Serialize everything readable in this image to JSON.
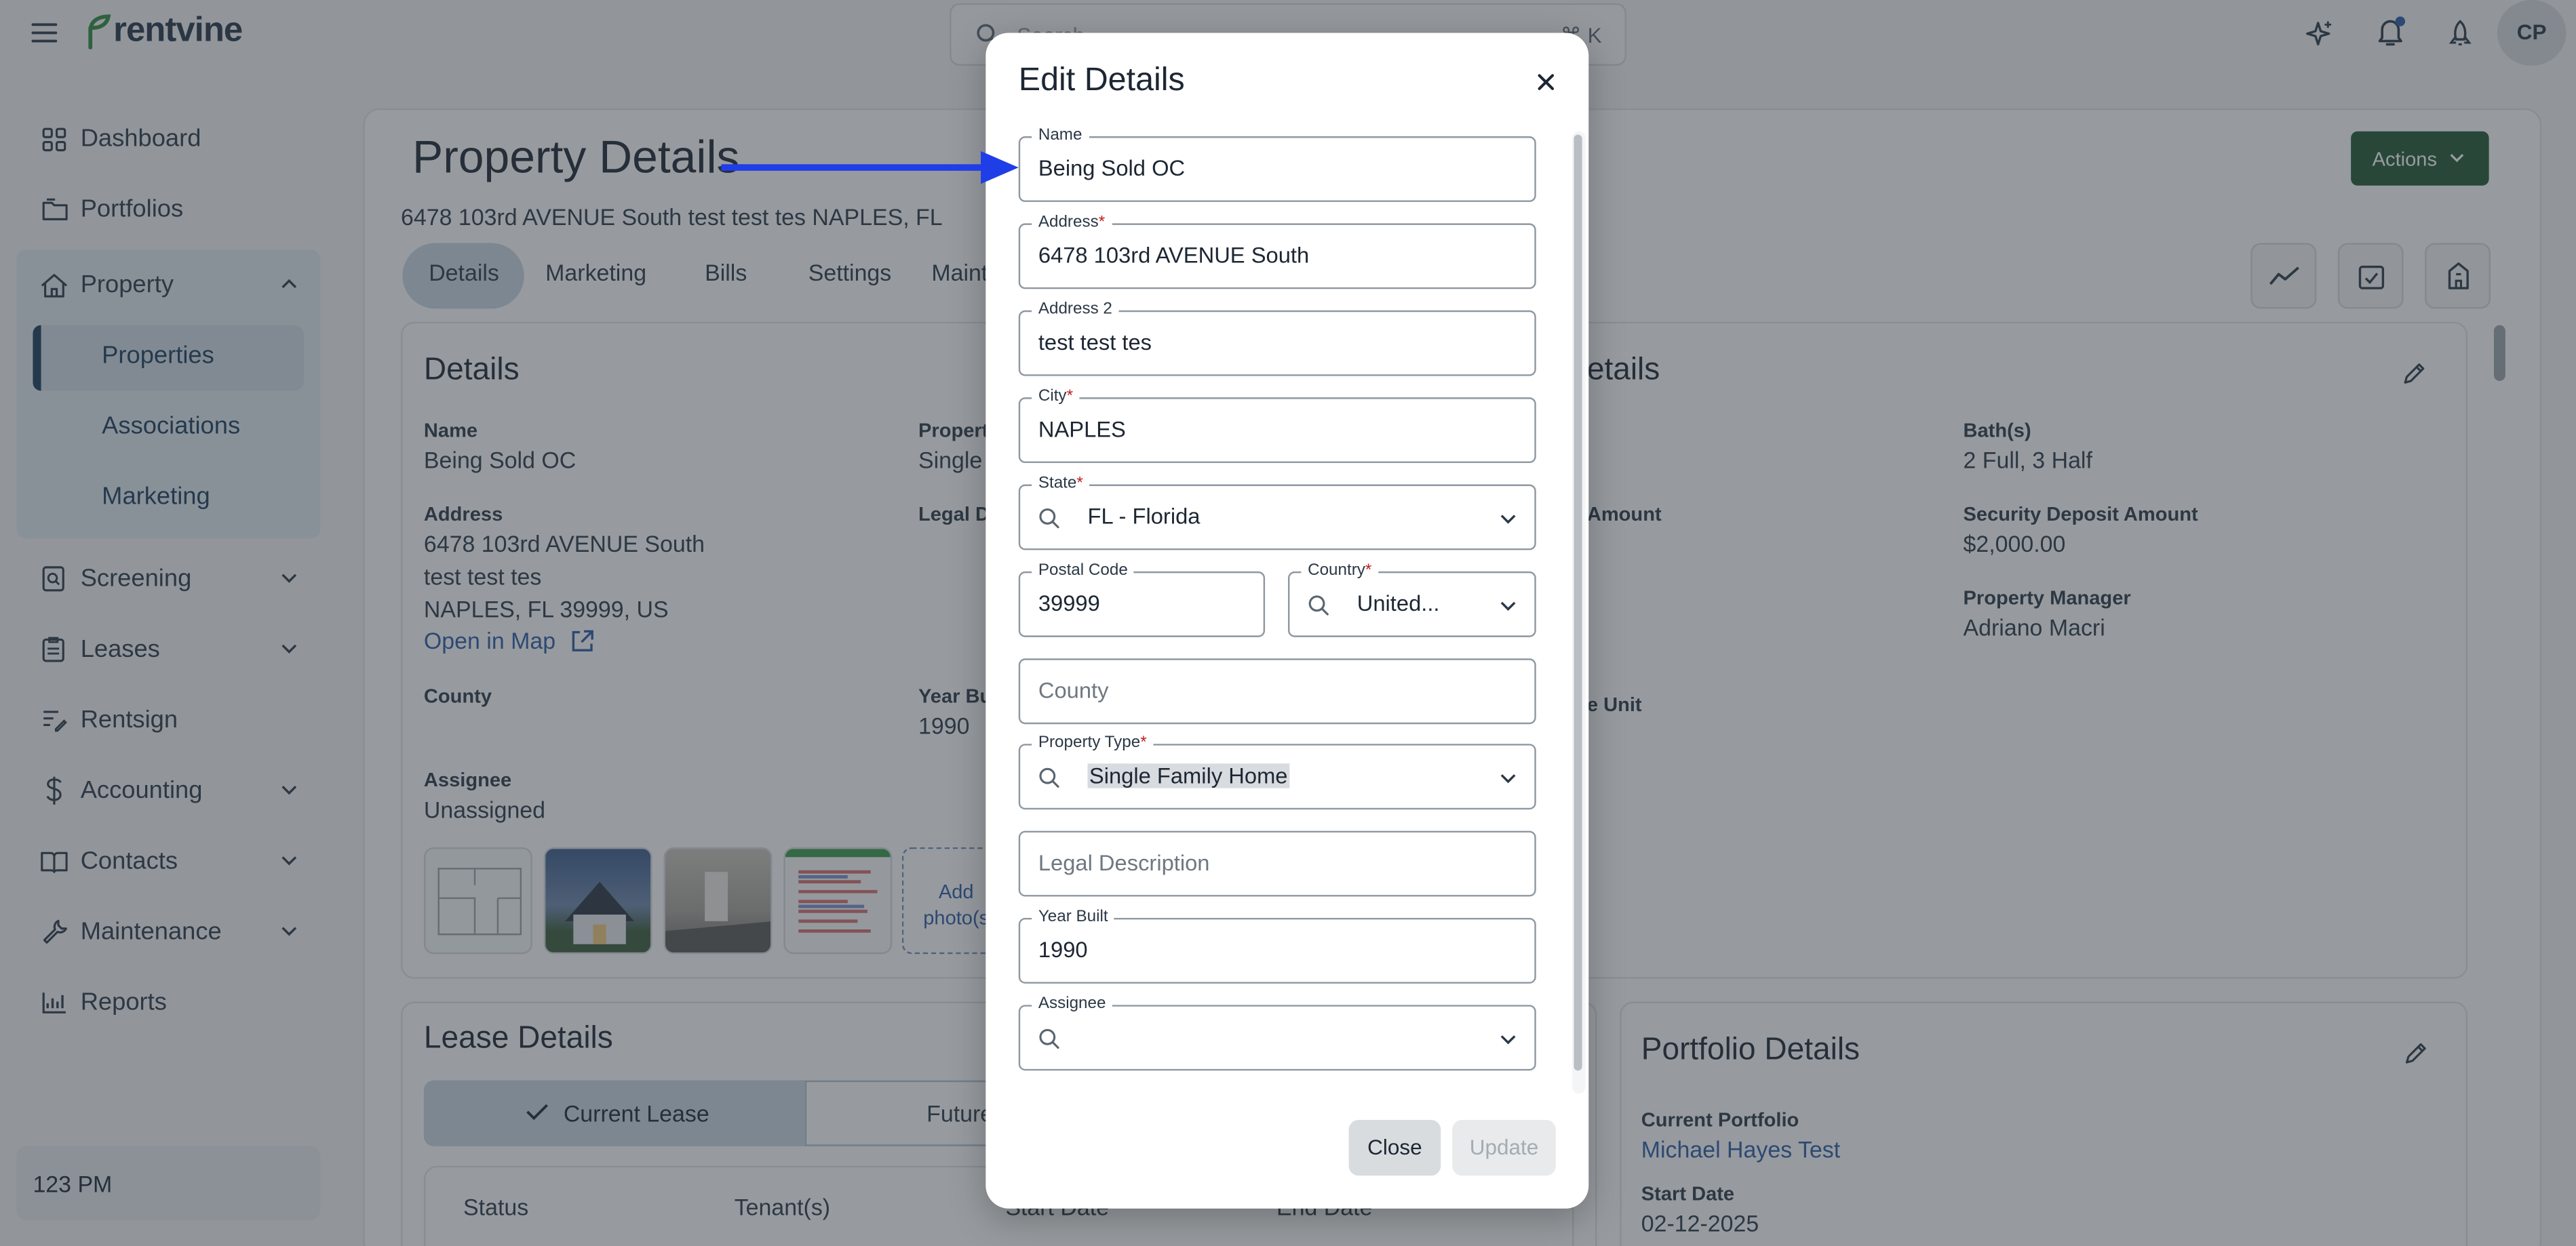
{
  "header": {
    "brand": "rentvine",
    "search_placeholder": "Search...",
    "search_shortcut": "⌘ K",
    "avatar_initials": "CP"
  },
  "sidebar": {
    "items": [
      {
        "label": "Dashboard"
      },
      {
        "label": "Portfolios"
      },
      {
        "label": "Property"
      },
      {
        "label": "Properties"
      },
      {
        "label": "Associations"
      },
      {
        "label": "Marketing"
      },
      {
        "label": "Screening"
      },
      {
        "label": "Leases"
      },
      {
        "label": "Rentsign"
      },
      {
        "label": "Accounting"
      },
      {
        "label": "Contacts"
      },
      {
        "label": "Maintenance"
      },
      {
        "label": "Reports"
      }
    ],
    "clock": "123 PM"
  },
  "page": {
    "title": "Property Details",
    "address_line": "6478 103rd AVENUE South test test tes NAPLES, FL",
    "actions_label": "Actions",
    "tabs": [
      "Details",
      "Marketing",
      "Bills",
      "Settings",
      "Maint"
    ]
  },
  "details_card": {
    "title": "Details",
    "name_label": "Name",
    "name_value": "Being Sold OC",
    "property_type_label": "Propert",
    "property_type_value": "Single",
    "address_label": "Address",
    "address_lines": [
      "6478 103rd AVENUE South",
      "test test tes",
      "NAPLES, FL 39999, US"
    ],
    "open_map": "Open in Map",
    "legal_label": "Legal D",
    "county_label": "County",
    "year_label": "Year Bu",
    "year_value": "1990",
    "assignee_label": "Assignee",
    "assignee_value": "Unassigned",
    "add_photo": "Add photo(s"
  },
  "right_card": {
    "title_fragment": "etails",
    "amount_fragment": "Amount",
    "unit_fragment": "e Unit",
    "baths_label": "Bath(s)",
    "baths_value": "2 Full, 3 Half",
    "deposit_label": "Security Deposit Amount",
    "deposit_value": "$2,000.00",
    "manager_label": "Property Manager",
    "manager_value": "Adriano Macri"
  },
  "lease_card": {
    "title": "Lease Details",
    "current_lease": "Current Lease",
    "future_fragment": "Future",
    "col_status": "Status",
    "col_tenants": "Tenant(s)",
    "col_start": "Start Date",
    "col_end": "End Date"
  },
  "portfolio_card": {
    "title": "Portfolio Details",
    "current_label": "Current Portfolio",
    "current_value": "Michael Hayes Test",
    "start_label": "Start Date",
    "start_value": "02-12-2025"
  },
  "modal": {
    "title": "Edit Details",
    "fields": {
      "name": {
        "label": "Name",
        "value": "Being Sold OC"
      },
      "address": {
        "label": "Address",
        "value": "6478 103rd AVENUE South"
      },
      "address2": {
        "label": "Address 2",
        "value": "test test tes"
      },
      "city": {
        "label": "City",
        "value": "NAPLES"
      },
      "state": {
        "label": "State",
        "value": "FL - Florida"
      },
      "postal": {
        "label": "Postal Code",
        "value": "39999"
      },
      "country": {
        "label": "Country",
        "value": "United..."
      },
      "county": {
        "placeholder": "County"
      },
      "property_type": {
        "label": "Property Type",
        "value": "Single Family Home"
      },
      "legal": {
        "placeholder": "Legal Description"
      },
      "year_built": {
        "label": "Year Built",
        "value": "1990"
      },
      "assignee": {
        "label": "Assignee",
        "value": ""
      }
    },
    "required_mark": "*",
    "close_button": "Close",
    "update_button": "Update"
  },
  "colors": {
    "accent_green": "#215732",
    "link_blue": "#2a5aa6",
    "annotation_arrow": "#1f3ee8",
    "required": "#c21d1d"
  },
  "icons": [
    "menu-icon",
    "search-icon",
    "sparkle-icon",
    "bell-icon",
    "rocket-icon",
    "dashboard-icon",
    "portfolio-icon",
    "home-icon",
    "chevron-icon",
    "screening-icon",
    "lease-icon",
    "sign-icon",
    "dollar-icon",
    "contacts-icon",
    "wrench-icon",
    "chart-icon",
    "external-link-icon",
    "trend-icon",
    "checklist-icon",
    "building-icon",
    "edit-icon",
    "check-icon",
    "close-icon",
    "arrow-annotation-icon"
  ]
}
